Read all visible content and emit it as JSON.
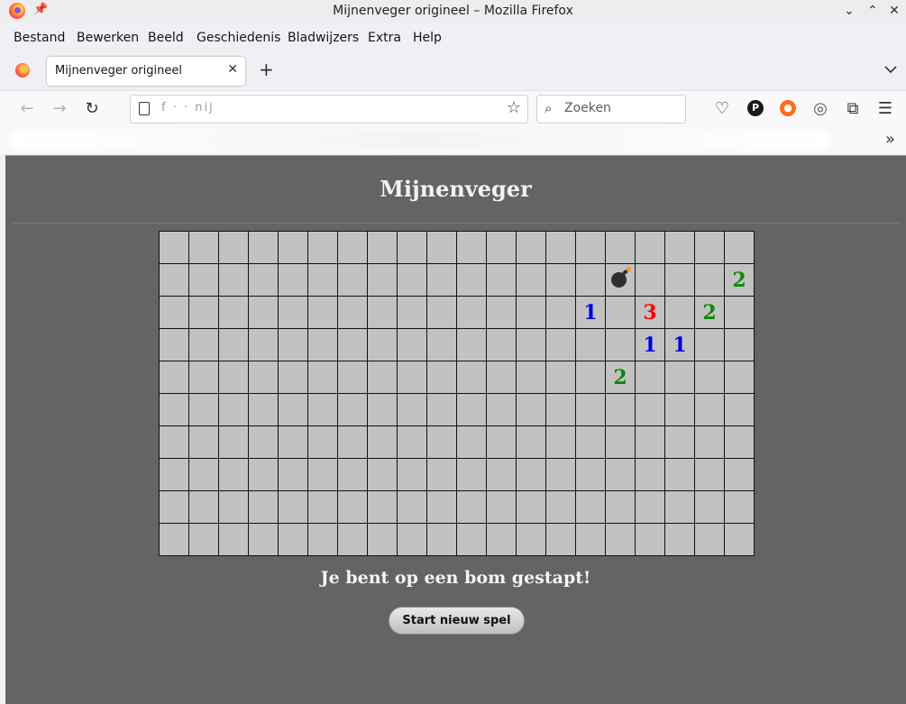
{
  "window": {
    "title": "Mijnenveger origineel – Mozilla Firefox"
  },
  "menu": [
    "Bestand",
    "Bewerken",
    "Beeld",
    "Geschiedenis",
    "Bladwijzers",
    "Extra",
    "Help"
  ],
  "tab": {
    "title": "Mijnenveger origineel",
    "close": "✕"
  },
  "navbar": {
    "url_fragment": "f  ·  ·  nij",
    "search_placeholder": "Zoeken"
  },
  "page": {
    "title": "Mijnenveger",
    "message": "Je bent op een bom gestapt!",
    "restart_label": "Start nieuw spel"
  },
  "board": {
    "rows": 10,
    "cols": 20,
    "cells": [
      {
        "row": 1,
        "col": 15,
        "bomb": true
      },
      {
        "row": 1,
        "col": 19,
        "value": "2",
        "color": "#0a8a0a"
      },
      {
        "row": 2,
        "col": 14,
        "value": "1",
        "color": "#0000e6"
      },
      {
        "row": 2,
        "col": 16,
        "value": "3",
        "color": "#ff0000"
      },
      {
        "row": 2,
        "col": 18,
        "value": "2",
        "color": "#0a8a0a"
      },
      {
        "row": 3,
        "col": 16,
        "value": "1",
        "color": "#0000e6"
      },
      {
        "row": 3,
        "col": 17,
        "value": "1",
        "color": "#0000e6"
      },
      {
        "row": 4,
        "col": 15,
        "value": "2",
        "color": "#0a8a0a"
      }
    ]
  }
}
